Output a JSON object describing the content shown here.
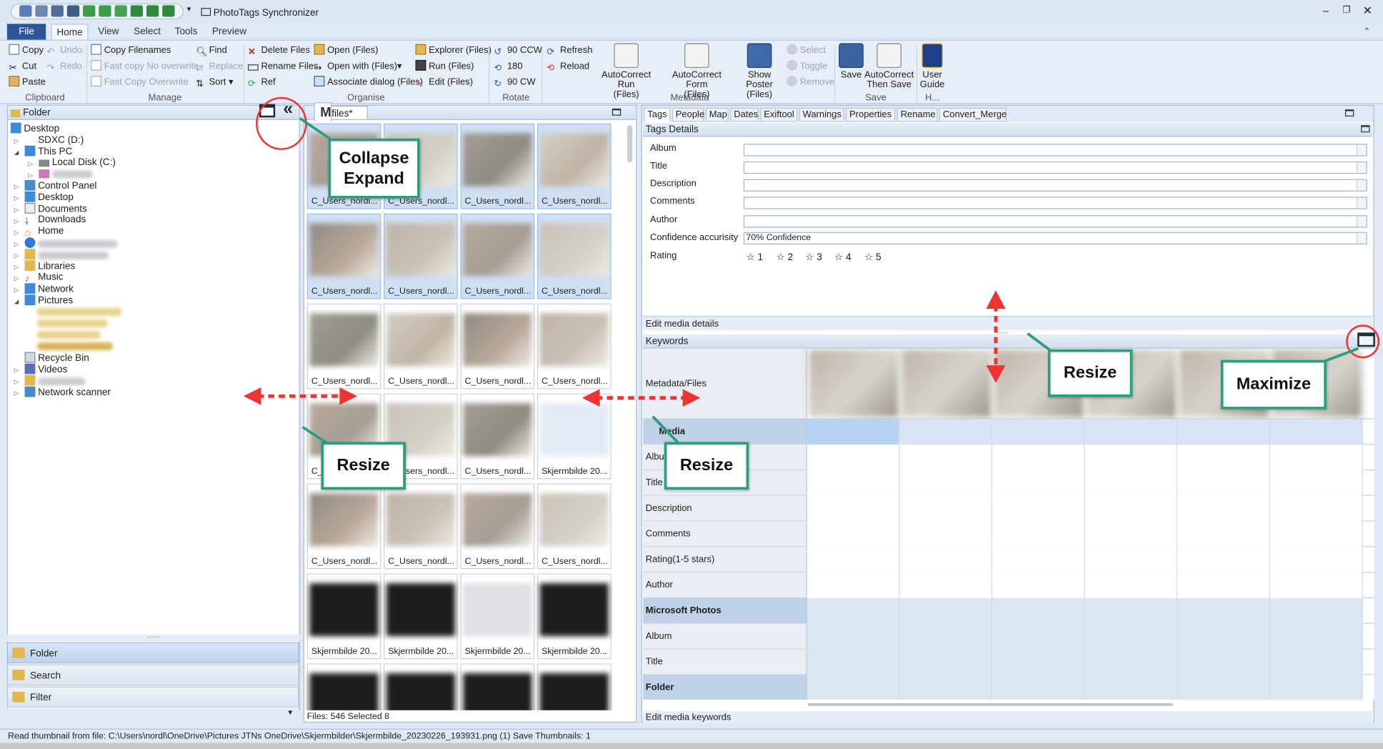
{
  "app": {
    "title": "PhotoTags Synchronizer"
  },
  "ribbon_tabs": [
    "File",
    "Home",
    "View",
    "Select",
    "Tools",
    "Preview"
  ],
  "clipboard": {
    "copy": "Copy",
    "cut": "Cut",
    "paste": "Paste",
    "undo": "Undo",
    "redo": "Redo",
    "label": "Clipboard"
  },
  "manage": {
    "copy_filenames": "Copy Filenames",
    "fast_copy_no": "Fast copy  No overwrite",
    "fast_copy_ow": "Fast Copy  Overwrite",
    "find": "Find",
    "replace": "Replace",
    "sort": "Sort",
    "label": "Manage"
  },
  "organise": {
    "delete": "Delete  Files",
    "rename": "Rename  Files",
    "ref": "Ref",
    "open": "Open  (Files)",
    "open_with": "Open with  (Files)",
    "assoc": "Associate dialog  (Files)",
    "explorer": "Explorer  (Files)",
    "run": "Run  (Files)",
    "edit": "Edit  (Files)",
    "label": "Organise"
  },
  "rotate": {
    "ccw": "90 CCW",
    "r180": "180",
    "cw": "90 CW",
    "label": "Rotate"
  },
  "refresh": {
    "refresh": "Refresh",
    "reload": "Reload"
  },
  "metadata": {
    "autocorrect_run": "AutoCorrect Run",
    "autocorrect_form": "AutoCorrect Form",
    "show_poster": "Show Poster",
    "files": "(Files)",
    "select": "Select",
    "toggle": "Toggle",
    "remove": "Remove",
    "label": "Metadata"
  },
  "save_group": {
    "save": "Save",
    "autocorrect": "AutoCorrect",
    "then_save": "Then Save",
    "label": "Save"
  },
  "help_group": {
    "user": "User",
    "guide": "Guide",
    "label": "H..."
  },
  "folder_panel": {
    "title": "Folder",
    "items": [
      "Desktop",
      "SDXC (D:)",
      "This PC",
      "Local Disk (C:)",
      "Control Panel",
      "Desktop",
      "Documents",
      "Downloads",
      "Home",
      "Libraries",
      "Music",
      "Network",
      "Pictures",
      "Recycle Bin",
      "Videos",
      "Network scanner"
    ],
    "nav": [
      "Folder",
      "Search",
      "Filter"
    ]
  },
  "files_panel": {
    "tab": "files*",
    "status": "Files: 546 Selected 8",
    "labels": [
      "C_Users_nordl...",
      "Skjermbilde 20..."
    ]
  },
  "right_tabs": [
    "Tags",
    "People",
    "Map",
    "Dates",
    "Exiftool",
    "Warnings",
    "Properties",
    "Rename",
    "Convert_Merge"
  ],
  "tags_details": {
    "title": "Tags Details",
    "fields": [
      "Album",
      "Title",
      "Description",
      "Comments",
      "Author",
      "Confidence accurisity",
      "Rating"
    ],
    "confidence_value": "70% Confidence",
    "stars": [
      "1",
      "2",
      "3",
      "4",
      "5"
    ],
    "footer": "Edit media details"
  },
  "keywords": {
    "title": "Keywords",
    "header": "Metadata/Files",
    "rows": [
      "Media",
      "Album",
      "Title",
      "Description",
      "Comments",
      "Rating(1-5 stars)",
      "Author",
      "Microsoft Photos",
      "Album",
      "Title",
      "Folder"
    ],
    "footer": "Edit media keywords"
  },
  "annotations": {
    "collapse": "Collapse",
    "expand": "Expand",
    "resize": "Resize",
    "maximize": "Maximize"
  },
  "status": {
    "text": "Read thumbnail from file: C:\\Users\\nordl\\OneDrive\\Pictures JTNs OneDrive\\Skjermbilder\\Skjermbilde_20230226_193931.png  (1) Save Thumbnails: 1"
  }
}
